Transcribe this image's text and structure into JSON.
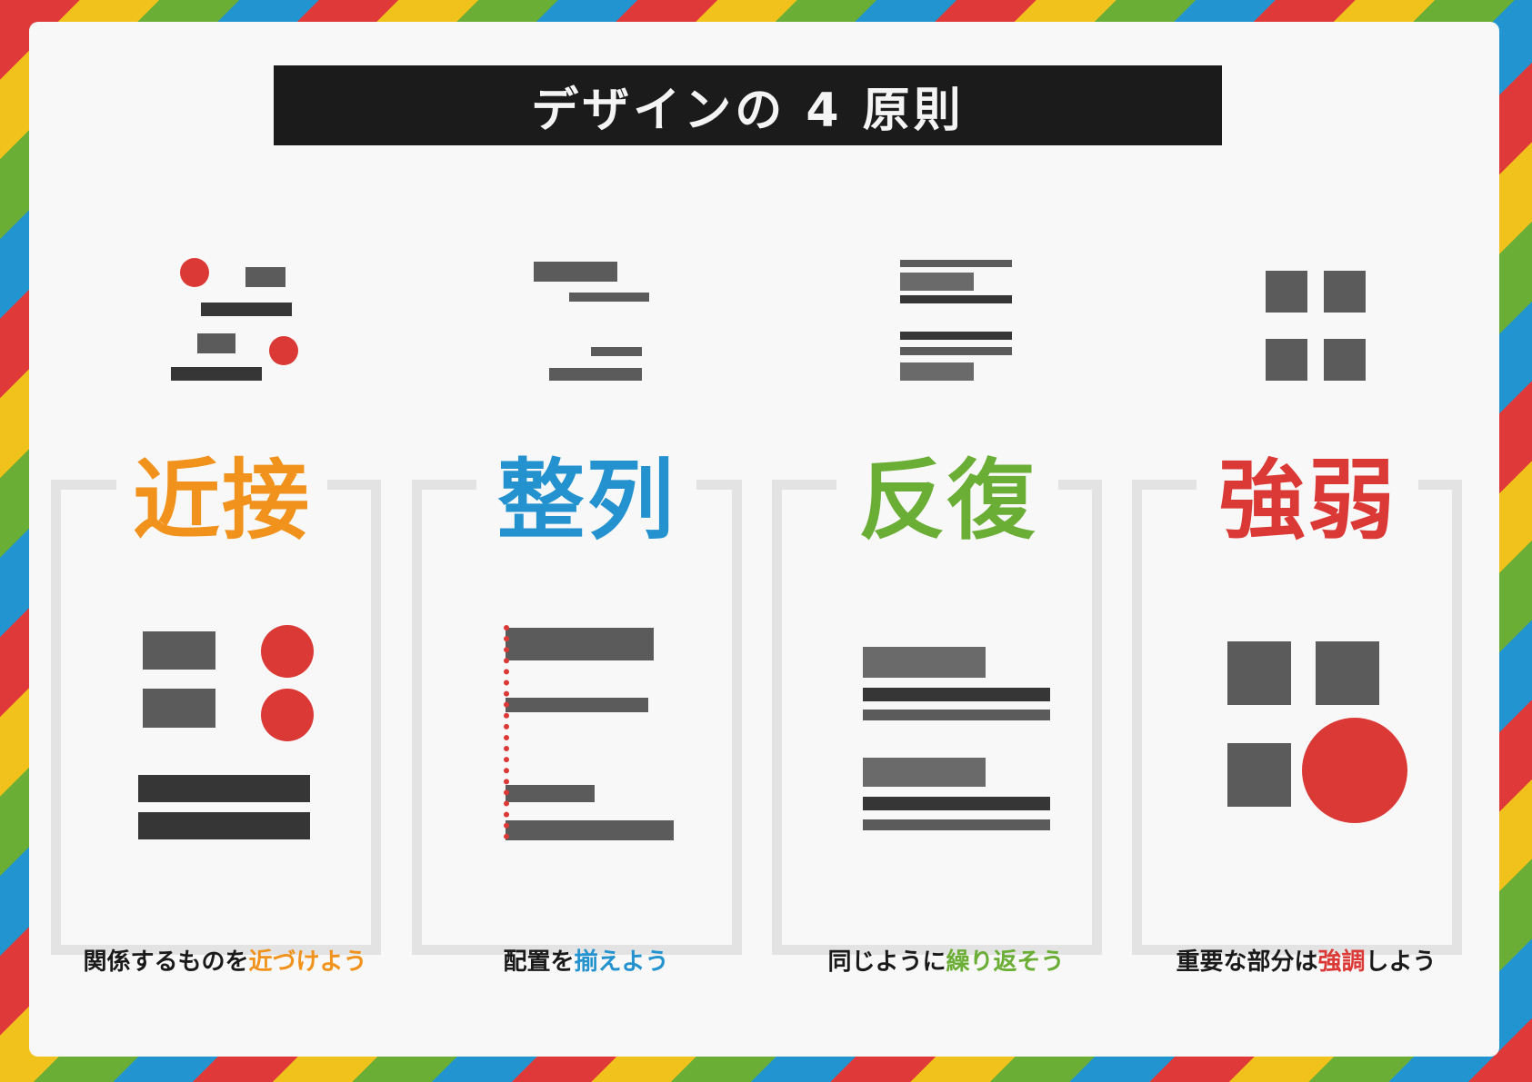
{
  "title": "デザインの 4 原則",
  "colors": {
    "proximity": "#f0921c",
    "alignment": "#2392cf",
    "repetition": "#6aae36",
    "contrast": "#db3936",
    "dark": "#1b1b1b"
  },
  "principles": [
    {
      "name": "近接",
      "caption_before": "関係するものを",
      "caption_highlight": "近づけよう",
      "caption_after": ""
    },
    {
      "name": "整列",
      "caption_before": "配置を",
      "caption_highlight": "揃えよう",
      "caption_after": ""
    },
    {
      "name": "反復",
      "caption_before": "同じように",
      "caption_highlight": "繰り返そう",
      "caption_after": ""
    },
    {
      "name": "強弱",
      "caption_before": "重要な部分は",
      "caption_highlight": "強調",
      "caption_after": "しよう"
    }
  ]
}
